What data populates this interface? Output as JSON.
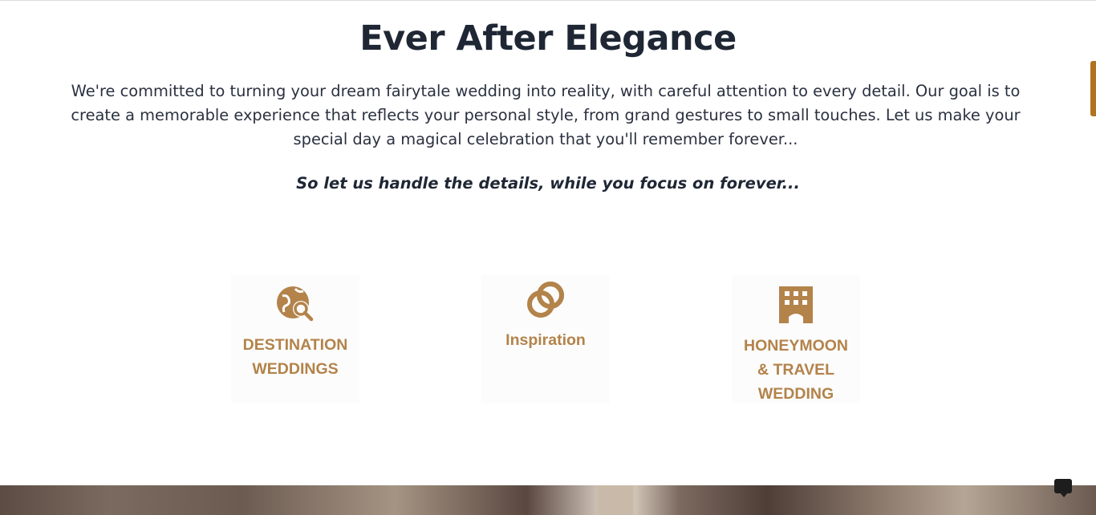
{
  "section": {
    "title": "Ever After Elegance",
    "intro": "We're committed to turning your dream fairytale wedding into reality, with careful attention to every detail. Our goal is to create a memorable experience that reflects your personal style, from grand gestures to small touches. Let us make your special day a magical celebration that you'll remember forever...",
    "tagline": "So let us handle the details, while you focus on forever..."
  },
  "cards": [
    {
      "icon": "globe-search-icon",
      "line1": "DESTINATION",
      "line2": "WEDDINGS",
      "line3": ""
    },
    {
      "icon": "rings-icon",
      "line1": "Inspiration",
      "line2": "",
      "line3": ""
    },
    {
      "icon": "hotel-building-icon",
      "line1": "HONEYMOON",
      "line2": "& TRAVEL",
      "line3": "WEDDING"
    }
  ],
  "colors": {
    "heading": "#1f2735",
    "accent_gold": "#b3834a",
    "scroll_indicator": "#b0731f"
  },
  "chat": {
    "icon": "chat-bubble-icon"
  }
}
